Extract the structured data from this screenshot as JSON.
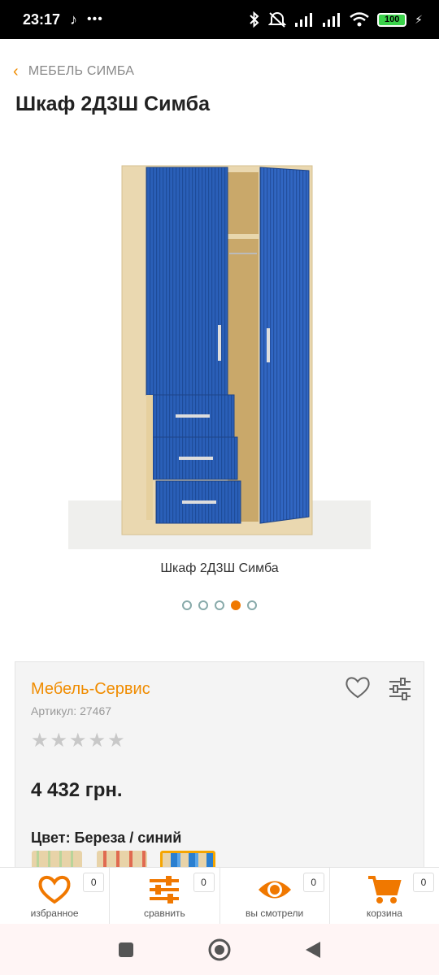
{
  "status_bar": {
    "time": "23:17",
    "battery": "100"
  },
  "breadcrumb": {
    "label": "МЕБЕЛЬ СИМБА"
  },
  "product": {
    "title": "Шкаф 2Д3Ш Симба",
    "image_caption": "Шкаф 2Д3Ш Симба",
    "carousel": {
      "total": 5,
      "active_index": 3
    },
    "brand": "Мебель-Сервис",
    "sku_label": "Артикул:",
    "sku_value": "27467",
    "rating": {
      "value": 0,
      "max": 5
    },
    "price": "4 432 грн.",
    "color_label": "Цвет: Береза / синий"
  },
  "colors": {
    "accent": "#f07800",
    "wardrobe_blue": "#2a5fb8",
    "body": "#ead8b0"
  },
  "bottom_nav": [
    {
      "label": "избранное",
      "count": "0",
      "icon": "heart-icon"
    },
    {
      "label": "сравнить",
      "count": "0",
      "icon": "sliders-icon"
    },
    {
      "label": "вы смотрели",
      "count": "0",
      "icon": "eye-icon"
    },
    {
      "label": "корзина",
      "count": "0",
      "icon": "cart-icon"
    }
  ]
}
